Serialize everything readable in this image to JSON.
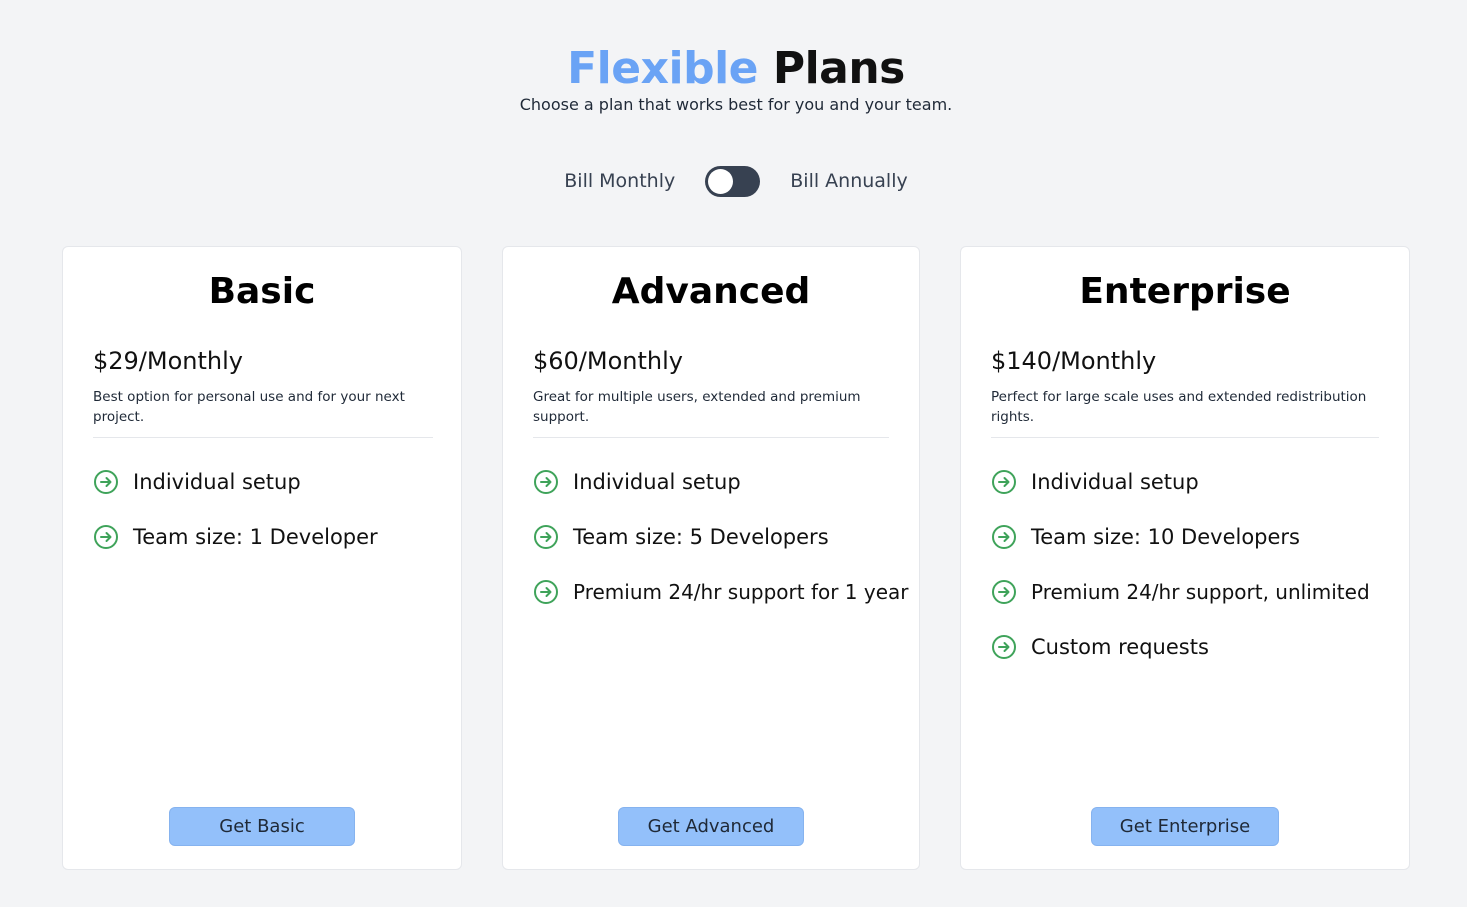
{
  "header": {
    "title_accent": "Flexible",
    "title_rest": " Plans",
    "subtitle": "Choose a plan that works best for you and your team."
  },
  "billing": {
    "monthly_label": "Bill Monthly",
    "annual_label": "Bill Annually",
    "toggle_state": "monthly"
  },
  "plans": [
    {
      "name": "Basic",
      "price": "$29/Monthly",
      "description": "Best option for personal use and for your next project.",
      "features": [
        "Individual setup",
        "Team size: 1 Developer"
      ],
      "cta": "Get Basic"
    },
    {
      "name": "Advanced",
      "price": "$60/Monthly",
      "description": "Great for multiple users, extended and premium support.",
      "features": [
        "Individual setup",
        "Team size: 5 Developers",
        "Premium 24/hr support for 1 year"
      ],
      "cta": "Get Advanced"
    },
    {
      "name": "Enterprise",
      "price": "$140/Monthly",
      "description": "Perfect for large scale uses and extended redistribution rights.",
      "features": [
        "Individual setup",
        "Team size: 10 Developers",
        "Premium 24/hr support, unlimited",
        "Custom requests"
      ],
      "cta": "Get Enterprise"
    }
  ],
  "icons": {
    "feature": "arrow-right-circle-icon"
  },
  "colors": {
    "accent": "#6aa3f5",
    "button": "#93c0fa",
    "check": "#3fa35a",
    "toggle": "#374151",
    "background": "#f3f4f6"
  }
}
